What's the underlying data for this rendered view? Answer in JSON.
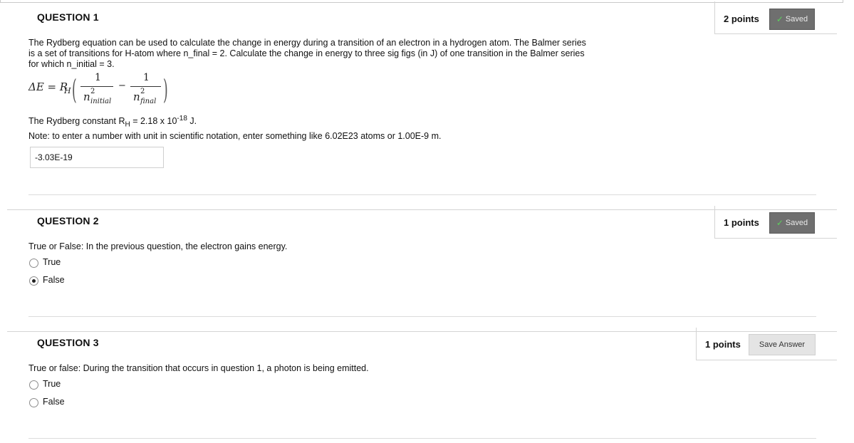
{
  "q1": {
    "title": "QUESTION 1",
    "points": "2 points",
    "saved_label": "Saved",
    "line1": "The Rydberg equation can be used to calculate the change in energy during a transition of an electron in a hydrogen atom.  The Balmer series",
    "line2": "is a set of transitions for H-atom where n_final = 2.  Calculate the change in energy to three sig figs (in J) of one transition in the Balmer series",
    "line3": "for which n_initial = 3.",
    "equation": {
      "lhs": "ΔE = R",
      "lhs_sub": "H",
      "one": "1",
      "n": "n",
      "sq": "2",
      "sub_initial": "initial",
      "sub_final": "final",
      "minus": "−"
    },
    "constant_prefix": "The Rydberg constant R",
    "constant_sub": "H",
    "constant_value": " = 2.18 x 10",
    "constant_exp": "-18",
    "constant_unit": " J.",
    "note": "Note: to enter a number with unit in scientific notation, enter something like 6.02E23 atoms or 1.00E-9 m.",
    "answer": "-3.03E-19"
  },
  "q2": {
    "title": "QUESTION 2",
    "points": "1 points",
    "saved_label": "Saved",
    "prompt": "True or False: In the previous question, the electron gains energy.",
    "options": [
      "True",
      "False"
    ],
    "selected": "False"
  },
  "q3": {
    "title": "QUESTION 3",
    "points": "1 points",
    "save_answer_label": "Save Answer",
    "prompt": "True or false: During the transition that occurs in question 1, a photon is being emitted.",
    "options": [
      "True",
      "False"
    ],
    "selected": null
  },
  "icons": {
    "saved": "check-icon"
  },
  "colors": {
    "saved_bg": "#6f6f6f",
    "check": "#5bd35b"
  }
}
